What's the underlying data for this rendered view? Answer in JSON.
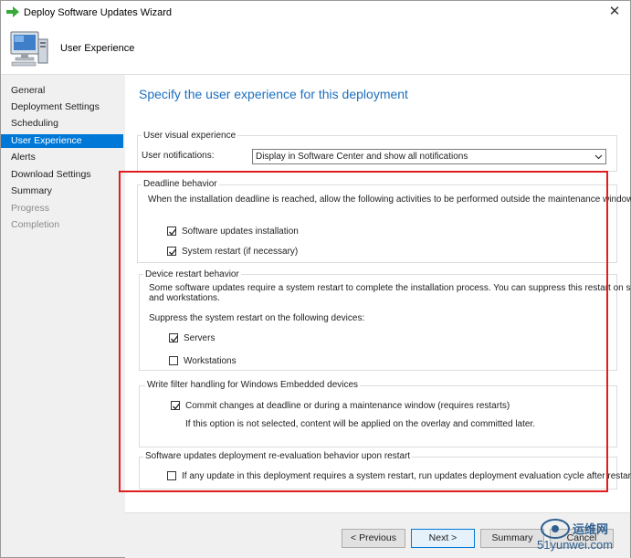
{
  "window": {
    "title": "Deploy Software Updates Wizard",
    "close_glyph": "✕"
  },
  "header": {
    "title": "User Experience",
    "icon": "computer-icon"
  },
  "sidebar": {
    "items": [
      {
        "label": "General",
        "state": "normal"
      },
      {
        "label": "Deployment Settings",
        "state": "normal"
      },
      {
        "label": "Scheduling",
        "state": "normal"
      },
      {
        "label": "User Experience",
        "state": "active"
      },
      {
        "label": "Alerts",
        "state": "normal"
      },
      {
        "label": "Download Settings",
        "state": "normal"
      },
      {
        "label": "Summary",
        "state": "normal"
      },
      {
        "label": "Progress",
        "state": "disabled"
      },
      {
        "label": "Completion",
        "state": "disabled"
      }
    ]
  },
  "main": {
    "page_title": "Specify the user experience for this deployment",
    "visual": {
      "group_label": "User visual experience",
      "notifications_label": "User notifications:",
      "notifications_value": "Display in Software Center and show all notifications"
    },
    "deadline": {
      "group_label": "Deadline behavior",
      "description": "When the installation deadline is reached, allow the following activities to be performed outside the maintenance window:",
      "software_updates_label": "Software updates installation",
      "software_updates_checked": true,
      "system_restart_label": "System restart (if necessary)",
      "system_restart_checked": true
    },
    "restart": {
      "group_label": "Device restart behavior",
      "description_line1": "Some software updates require a system restart to complete the installation process. You can suppress this restart on servers",
      "description_line2": "and workstations.",
      "suppress_label": "Suppress the system restart on the following devices:",
      "servers_label": "Servers",
      "servers_checked": true,
      "workstations_label": "Workstations",
      "workstations_checked": false
    },
    "write_filter": {
      "group_label": "Write filter handling for Windows Embedded devices",
      "commit_label": "Commit changes at deadline or during a maintenance window (requires restarts)",
      "commit_checked": true,
      "note": "If this option is not selected, content will be applied on the overlay and committed later."
    },
    "reevaluation": {
      "group_label": "Software updates deployment re-evaluation behavior upon restart",
      "option_label": "If any update in this deployment requires a system restart, run updates deployment evaluation cycle after restart",
      "option_checked": false
    }
  },
  "buttons": {
    "previous": "< Previous",
    "next": "Next >",
    "summary": "Summary",
    "cancel": "Cancel"
  },
  "watermark": {
    "line1": "运维网",
    "line2": "51yunwei.com"
  },
  "colors": {
    "accent": "#0078d7",
    "title_blue": "#1c6fbf",
    "highlight_red": "#e21d1d"
  }
}
